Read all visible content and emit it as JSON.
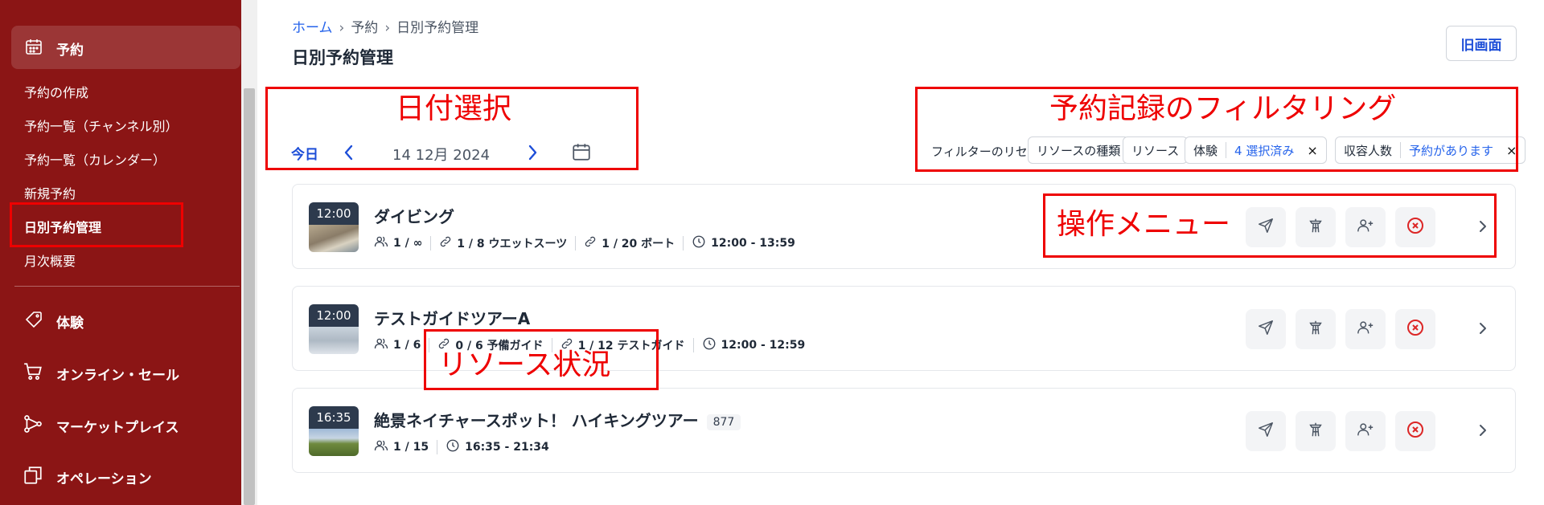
{
  "sidebar": {
    "main_label": "予約",
    "sub_items": [
      "予約の作成",
      "予約一覧（チャンネル別）",
      "予約一覧（カレンダー）",
      "新規予約",
      "日別予約管理",
      "月次概要"
    ],
    "sections": [
      "体験",
      "オンライン・セール",
      "マーケットプレイス",
      "オペレーション"
    ]
  },
  "breadcrumb": {
    "home": "ホーム",
    "sep": "›",
    "reservations": "予約",
    "current": "日別予約管理"
  },
  "page_title": "日別予約管理",
  "old_screen_button": "旧画面",
  "date_selector": {
    "today": "今日",
    "date": "14 12月 2024"
  },
  "filters": {
    "reset": "フィルターのリセット",
    "resource_type": "リソースの種類",
    "resource": "リソース",
    "experience_label": "体験",
    "experience_value": "4 選択済み",
    "capacity_label": "収容人数",
    "capacity_value": "予約があります",
    "remove": "×"
  },
  "bookings": [
    {
      "time": "12:00",
      "title": "ダイビング",
      "tag": "",
      "meta": [
        "1 / ∞",
        "1 / 8 ウエットスーツ",
        "1 / 20 ボート",
        "12:00 - 13:59"
      ]
    },
    {
      "time": "12:00",
      "title": "テストガイドツアーA",
      "tag": "",
      "meta": [
        "1 / 6",
        "0 / 6 予備ガイド",
        "1 / 12 テストガイド",
        "12:00 - 12:59"
      ]
    },
    {
      "time": "16:35",
      "title": "絶景ネイチャースポット！ ハイキングツアー",
      "tag": "877",
      "meta": [
        "1 / 15",
        "16:35 - 21:34"
      ]
    }
  ],
  "annotations": {
    "date_select": "日付選択",
    "filtering": "予約記録のフィルタリング",
    "operations_menu": "操作メニュー",
    "resource_status": "リソース状況"
  },
  "colors": {
    "sidebar": "#8b1515",
    "accent": "#1d4ed8",
    "annotation": "#ee0000"
  },
  "icons": [
    "calendar-icon",
    "tag-icon",
    "cart-icon",
    "marketplace-icon",
    "copy-icon",
    "users-icon",
    "link-icon",
    "clock-icon",
    "send-icon",
    "guide-icon",
    "add-user-icon",
    "cancel-icon",
    "chevron-right-icon"
  ]
}
